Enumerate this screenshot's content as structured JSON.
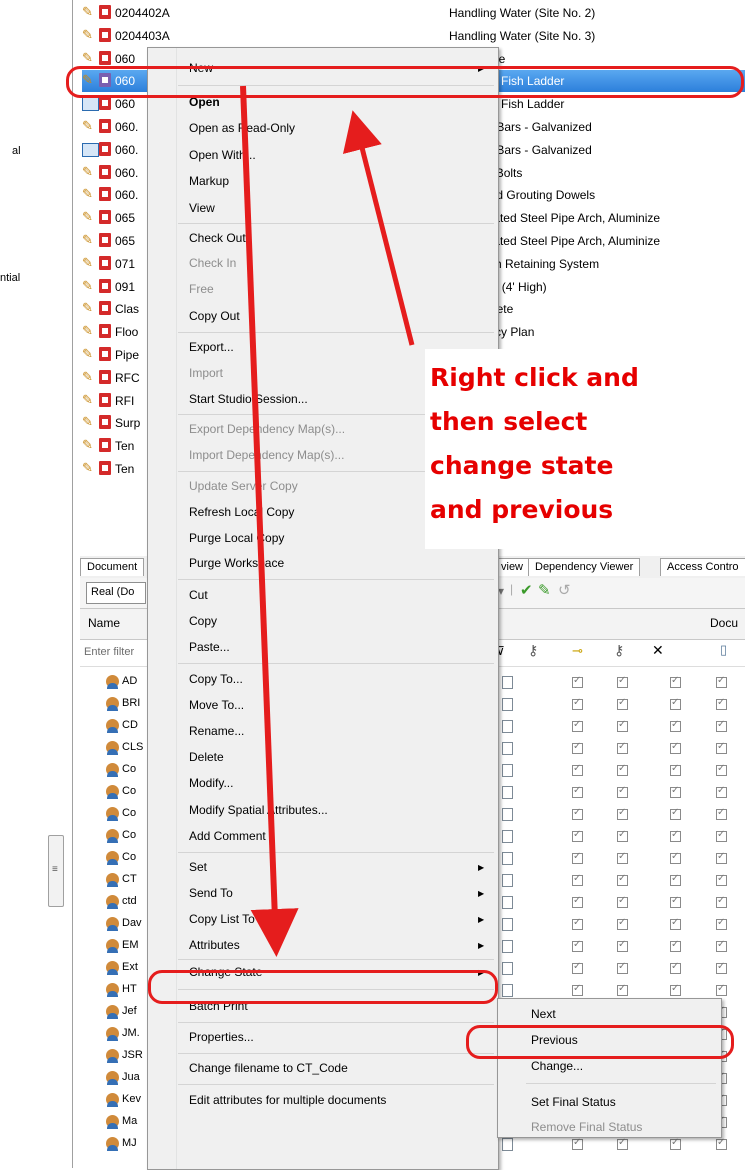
{
  "left_panel": {
    "labels": [
      "al",
      "ntial"
    ],
    "splitter_glyph": "≡"
  },
  "doc_rows": [
    {
      "code": "0204402A",
      "title": "Handling Water (Site No. 2)",
      "icon": "pencil-pdf"
    },
    {
      "code": "0204403A",
      "title": "Handling Water (Site No. 3)",
      "icon": "pencil-pdf"
    },
    {
      "code": "060",
      "title": "\" Concrete",
      "icon": "pencil-pdf"
    },
    {
      "code": "060",
      "title": "Concrete Fish Ladder",
      "icon": "pencil-pdf",
      "selected": true
    },
    {
      "code": "060",
      "title": "Concrete Fish Ladder",
      "icon": "book-pdf"
    },
    {
      "code": "060.",
      "title": "ed Steel Bars - Galvanized",
      "icon": "pencil-pdf"
    },
    {
      "code": "060.",
      "title": "ed Steel Bars - Galvanized",
      "icon": "book-pdf"
    },
    {
      "code": "060.",
      "title": "l Anchor Bolts",
      "icon": "pencil-pdf"
    },
    {
      "code": "060.",
      "title": "Holes and Grouting Dowels",
      "icon": "pencil-pdf"
    },
    {
      "code": "065",
      "title": "\" Corrugated Steel Pipe Arch, Aluminize",
      "icon": "pencil-pdf"
    },
    {
      "code": "065",
      "title": "\" Corrugated Steel Pipe Arch, Aluminize",
      "icon": "pencil-pdf"
    },
    {
      "code": "071",
      "title": "rary Earth Retaining System",
      "icon": "pencil-pdf"
    },
    {
      "code": "091",
      "title": "ve Fence (4' High)",
      "icon": "pencil-pdf"
    },
    {
      "code": "Clas",
      "title": "A\" Concrete",
      "icon": "pencil-pdf"
    },
    {
      "code": "Floo",
      "title": "ontingency Plan",
      "icon": "pencil-pdf"
    },
    {
      "code": "Pipe",
      "title": "",
      "icon": "pencil-pdf"
    },
    {
      "code": "RFC",
      "title": "",
      "icon": "pencil-pdf"
    },
    {
      "code": "RFI",
      "title": "",
      "icon": "pencil-pdf"
    },
    {
      "code": "Surp",
      "title": "",
      "icon": "pencil-pdf"
    },
    {
      "code": "Ten",
      "title": "",
      "icon": "pencil-pdf"
    },
    {
      "code": "Ten",
      "title": "",
      "icon": "pencil-pdf"
    }
  ],
  "context_menu": {
    "items": [
      {
        "label": "New",
        "arrow": true
      },
      {
        "label": "Open",
        "bold": true
      },
      {
        "label": "Open as Read-Only"
      },
      {
        "label": "Open With..."
      },
      {
        "label": "Markup"
      },
      {
        "label": "View"
      },
      {
        "label": "Check Out"
      },
      {
        "label": "Check In",
        "disabled": true
      },
      {
        "label": "Free",
        "disabled": true
      },
      {
        "label": "Copy Out"
      },
      {
        "label": "Export..."
      },
      {
        "label": "Import",
        "disabled": true
      },
      {
        "label": "Start Studio Session..."
      },
      {
        "label": "Export Dependency Map(s)...",
        "disabled": true
      },
      {
        "label": "Import Dependency Map(s)...",
        "disabled": true
      },
      {
        "label": "Update Server Copy",
        "disabled": true
      },
      {
        "label": "Refresh Local Copy"
      },
      {
        "label": "Purge Local Copy"
      },
      {
        "label": "Purge Workspace"
      },
      {
        "label": "Cut"
      },
      {
        "label": "Copy"
      },
      {
        "label": "Paste..."
      },
      {
        "label": "Copy To..."
      },
      {
        "label": "Move To..."
      },
      {
        "label": "Rename..."
      },
      {
        "label": "Delete"
      },
      {
        "label": "Modify..."
      },
      {
        "label": "Modify Spatial Attributes..."
      },
      {
        "label": "Add Comment"
      },
      {
        "label": "Set",
        "arrow": true
      },
      {
        "label": "Send To",
        "arrow": true
      },
      {
        "label": "Copy List To",
        "arrow": true
      },
      {
        "label": "Attributes",
        "arrow": true
      },
      {
        "label": "Change State",
        "arrow": true,
        "highlighted": true
      },
      {
        "label": "Batch Print"
      },
      {
        "label": "Properties..."
      },
      {
        "label": "Change filename to CT_Code"
      },
      {
        "label": "Edit attributes for multiple documents"
      }
    ]
  },
  "submenu": {
    "items": [
      {
        "label": "Next"
      },
      {
        "label": "Previous",
        "highlighted": true
      },
      {
        "label": "Change..."
      },
      {
        "label": "Set Final Status"
      },
      {
        "label": "Remove Final Status",
        "disabled": true
      }
    ]
  },
  "lower_panel": {
    "tabs": [
      "Document",
      "view",
      "Dependency Viewer",
      "Access Contro"
    ],
    "realbox": "Real (Do",
    "col_name": "Name",
    "col_docu": "Docu",
    "filter_placeholder": "Enter filter",
    "users": [
      "AD",
      "BRI",
      "CD",
      "CLS",
      "Co",
      "Co",
      "Co",
      "Co",
      "Co",
      "CT",
      "ctd",
      "Dav",
      "EM",
      "Ext",
      "HT",
      "Jef",
      "JM.",
      "JSR",
      "Jua",
      "Kev",
      "Ma",
      "MJ"
    ]
  },
  "callout": {
    "lines": [
      "Right click and",
      "then select",
      "change state",
      "and previous"
    ]
  }
}
